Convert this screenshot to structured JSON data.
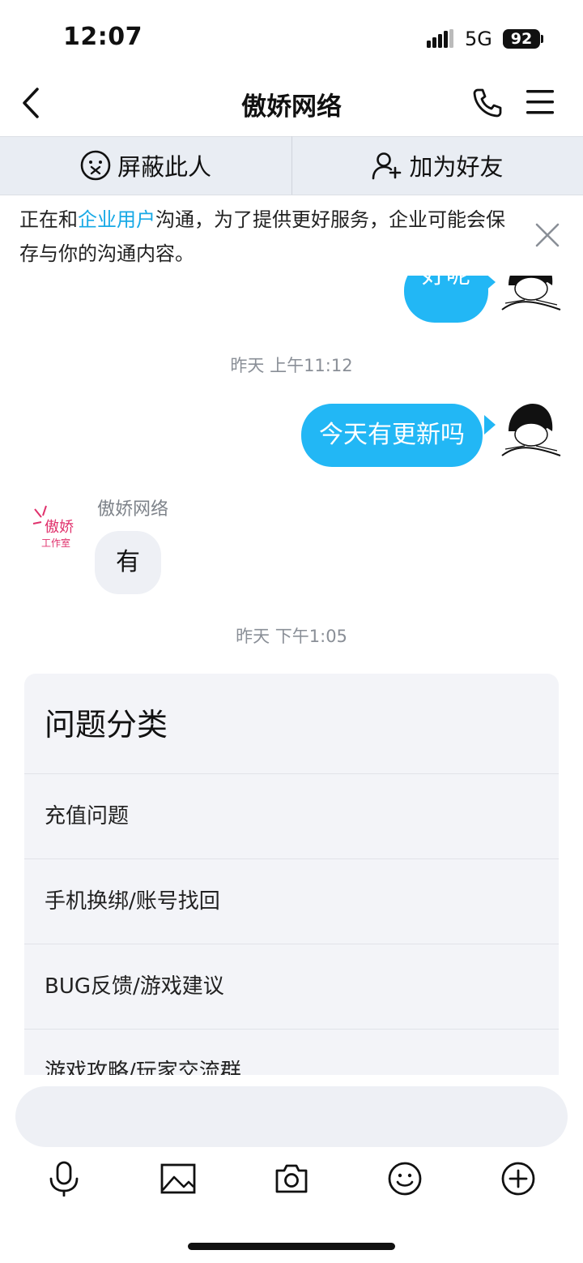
{
  "status": {
    "time": "12:07",
    "network": "5G",
    "battery": "92"
  },
  "nav": {
    "title": "傲娇网络"
  },
  "actions": {
    "block_label": "屏蔽此人",
    "add_friend_label": "加为好友"
  },
  "notice": {
    "prefix": "正在和",
    "highlight": "企业用户",
    "suffix": "沟通，为了提供更好服务，企业可能会保存与你的沟通内容。"
  },
  "messages": {
    "msg1": "好呢",
    "time1": "昨天 上午11:12",
    "msg2": "今天有更新吗",
    "sender": "傲娇网络",
    "reply": "有",
    "time2": "昨天 下午1:05",
    "logo_text_top": "傲娇",
    "logo_text_bottom": "工作室"
  },
  "card": {
    "title": "问题分类",
    "items": [
      "充值问题",
      "手机换绑/账号找回",
      "BUG反馈/游戏建议",
      "游戏攻略/玩家交流群"
    ]
  },
  "input": {
    "placeholder": ""
  },
  "toolbar": [
    "mic-icon",
    "image-icon",
    "camera-icon",
    "emoji-icon",
    "plus-icon"
  ],
  "colors": {
    "accent": "#22b7f5",
    "link": "#17a9e6",
    "bar_bg": "#e9edf3"
  }
}
